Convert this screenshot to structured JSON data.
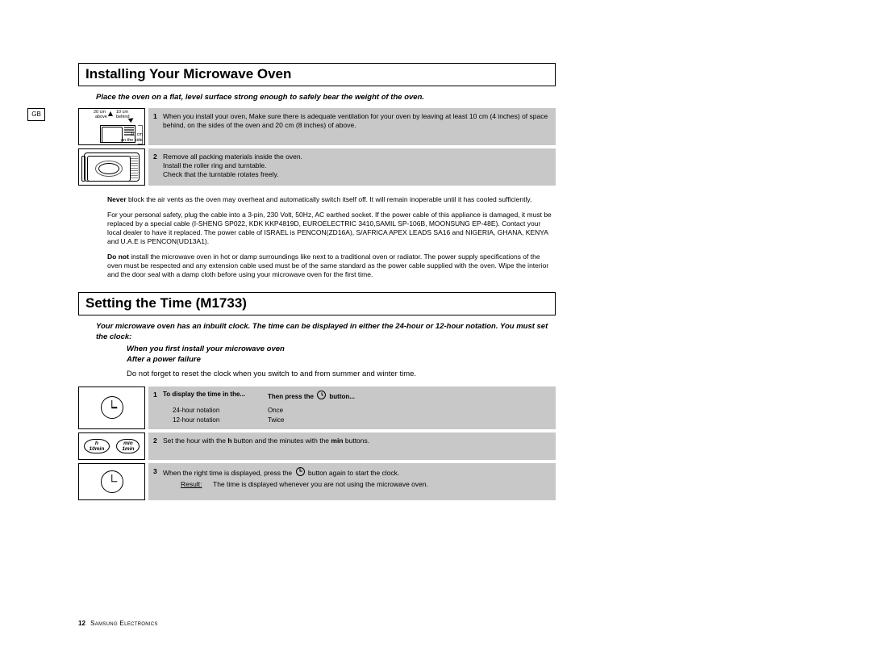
{
  "region_marker": "GB",
  "section1": {
    "title": "Installing Your Microwave Oven",
    "intro": "Place the oven on a flat, level surface strong enough to safely bear the weight of the oven.",
    "diagram1": {
      "above": "20 cm",
      "above2": "above",
      "behind": "10 cm",
      "behind2": "behind",
      "side": "10 cm",
      "side2": "on the side"
    },
    "step1_num": "1",
    "step1_text": "When you install your oven, Make sure there is adequate ventilation for your oven by leaving at least 10 cm (4 inches) of space behind, on the sides of the oven and 20 cm (8 inches) of above.",
    "step2_num": "2",
    "step2_line1": "Remove all packing materials inside the oven.",
    "step2_line2": "Install the roller ring and turntable.",
    "step2_line3": "Check that the turntable rotates freely.",
    "para_never_b": "Never",
    "para_never": " block the air vents as the oven may overheat and automatically switch itself off. It will remain inoperable until it has cooled sufficiently.",
    "para_safety": "For your personal safety, plug the cable into a 3-pin, 230 Volt, 50Hz, AC earthed socket. If the power cable of this appliance is damaged, it must be replaced by a special cable (I-SHENG SP022, KDK KKP4819D, EUROELECTRIC 3410,SAMIL SP-106B, MOONSUNG EP-48E). Contact your local dealer to have it replaced. The power cable of ISRAEL is PENCON(ZD16A), S/AFRICA APEX LEADS SA16 and NIGERIA, GHANA, KENYA and U.A.E is PENCON(UD13A1).",
    "para_donot_b": "Do not",
    "para_donot": " install the microwave oven in hot or damp surroundings like next to a traditional oven or radiator. The power supply specifications of the oven must be respected and any extension cable used must be of the same standard as the power cable supplied with the oven. Wipe the interior and the door seal with a damp cloth before using your microwave oven for the first time."
  },
  "section2": {
    "title": "Setting the Time (M1733)",
    "intro": "Your microwave oven has an inbuilt clock. The time can be displayed in either the 24-hour or 12-hour notation. You must set the clock:",
    "bullet1": "When you first install your microwave oven",
    "bullet2": "After a power failure",
    "summer": "Do not forget to reset the clock when you switch to and from summer and winter time.",
    "s1_num": "1",
    "s1_head1": "To display the time in the...",
    "s1_head2_a": "Then press the",
    "s1_head2_b": "button...",
    "s1_r1a": "24-hour notation",
    "s1_r1b": "Once",
    "s1_r2a": "12-hour notation",
    "s1_r2b": "Twice",
    "s2_num": "2",
    "s2_text_a": "Set the hour with the ",
    "s2_text_h": "h",
    "s2_text_b": " button and the minutes with the ",
    "s2_text_min": "min",
    "s2_text_c": " buttons.",
    "btn_h": "h\n10min",
    "btn_min": "min\n1min",
    "s3_num": "3",
    "s3_text_a": "When the right time is displayed, press the ",
    "s3_text_b": " button again to start the clock.",
    "s3_result_label": "Result:",
    "s3_result_text": "The time is displayed whenever you are not using the microwave oven."
  },
  "footer": {
    "page": "12",
    "brand": "Samsung Electronics"
  }
}
